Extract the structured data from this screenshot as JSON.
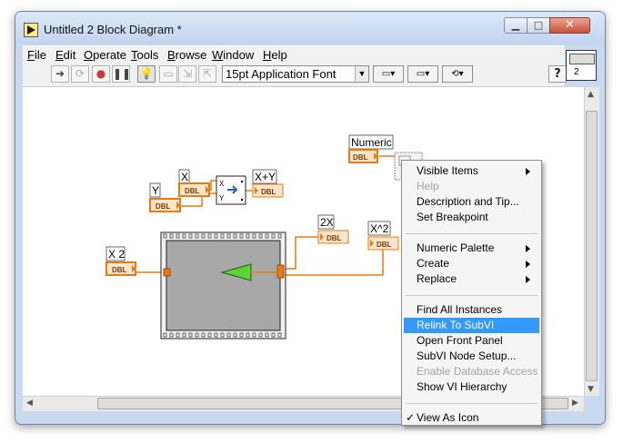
{
  "window": {
    "title": "Untitled 2 Block Diagram *",
    "minimize": "▁",
    "maximize": "□",
    "close": "✕"
  },
  "menu": [
    {
      "key": "F",
      "rest": "ile"
    },
    {
      "key": "E",
      "rest": "dit"
    },
    {
      "key": "O",
      "rest": "perate"
    },
    {
      "key": "T",
      "rest": "ools"
    },
    {
      "key": "B",
      "rest": "rowse"
    },
    {
      "key": "W",
      "rest": "indow"
    },
    {
      "key": "H",
      "rest": "elp"
    }
  ],
  "toolbar": {
    "font": "15pt Application Font",
    "help": "?",
    "vi_icon_number": "2"
  },
  "diagram": {
    "labels": {
      "numeric": "Numeric",
      "x": "X",
      "y": "Y",
      "x_plus_y": "X+Y",
      "two_x": "2X",
      "x_squared": "X^2",
      "x2": "X 2"
    },
    "dbl": "DBL",
    "subvi_terminals": {
      "x": "X",
      "y": "Y"
    }
  },
  "context_menu": {
    "items": [
      {
        "label": "Visible Items",
        "submenu": true
      },
      {
        "label": "Help",
        "disabled": true
      },
      {
        "label": "Description and Tip..."
      },
      {
        "label": "Set Breakpoint"
      },
      {
        "separator": true
      },
      {
        "label": "Numeric Palette",
        "submenu": true
      },
      {
        "label": "Create",
        "submenu": true
      },
      {
        "label": "Replace",
        "submenu": true
      },
      {
        "separator": true
      },
      {
        "label": "Find All Instances"
      },
      {
        "label": "Relink To SubVI",
        "highlighted": true
      },
      {
        "label": "Open Front Panel"
      },
      {
        "label": "SubVI Node Setup..."
      },
      {
        "label": "Enable Database Access",
        "disabled": true
      },
      {
        "label": "Show VI Hierarchy"
      },
      {
        "separator": true
      },
      {
        "label": "View As Icon",
        "checked": true
      }
    ]
  },
  "colors": {
    "wire_orange": "#e87a12",
    "terminal_fill": "#fbe6cc",
    "loop_gray": "#a8a8a8",
    "highlight": "#3399ff"
  },
  "icons": {
    "run_arrow": "run-arrow-icon",
    "abort": "abort-icon",
    "pause": "pause-icon",
    "highlight_execution": "lightbulb-icon"
  }
}
